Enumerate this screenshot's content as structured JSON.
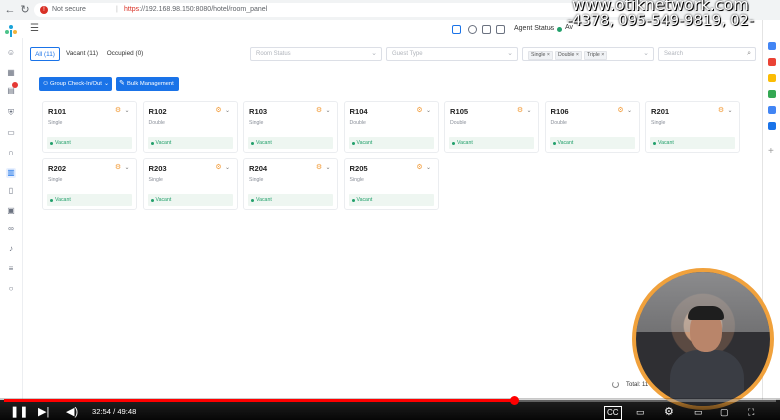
{
  "browser": {
    "security_label": "Not secure",
    "url_scheme": "https",
    "url_rest": "://192.168.98.150:8080/hotel/room_panel"
  },
  "header": {
    "agent_status_label": "Agent Status",
    "agent_status_value": "Av"
  },
  "filters": {
    "tabs": [
      {
        "label": "All (11)",
        "active": true
      },
      {
        "label": "Vacant (11)",
        "active": false
      },
      {
        "label": "Occupied (0)",
        "active": false
      }
    ],
    "room_status_placeholder": "Room Status",
    "guest_type_placeholder": "Guest Type",
    "room_type_tags": [
      "Single",
      "Double",
      "Triple"
    ],
    "search_placeholder": "Search"
  },
  "actions": {
    "group_check": "Group Check-In/Out",
    "batch": "Bulk Management"
  },
  "rooms": [
    {
      "number": "R101",
      "type": "Single",
      "status": "Vacant"
    },
    {
      "number": "R102",
      "type": "Double",
      "status": "Vacant"
    },
    {
      "number": "R103",
      "type": "Single",
      "status": "Vacant"
    },
    {
      "number": "R104",
      "type": "Double",
      "status": "Vacant"
    },
    {
      "number": "R105",
      "type": "Double",
      "status": "Vacant"
    },
    {
      "number": "R106",
      "type": "Double",
      "status": "Vacant"
    },
    {
      "number": "R201",
      "type": "Single",
      "status": "Vacant"
    },
    {
      "number": "R202",
      "type": "Single",
      "status": "Vacant"
    },
    {
      "number": "R203",
      "type": "Single",
      "status": "Vacant"
    },
    {
      "number": "R204",
      "type": "Single",
      "status": "Vacant"
    },
    {
      "number": "R205",
      "type": "Single",
      "status": "Vacant"
    }
  ],
  "footer": {
    "total": "Total: 11"
  },
  "overlay": {
    "watermark": "www.otiknetwork.com",
    "phone": "-4378, 095-549-9819, 02-"
  },
  "video": {
    "time": "32:54 / 49:48",
    "progress": 0.66
  },
  "colors": {
    "accent": "#1a73e8",
    "vacant": "#22a06b",
    "progress": "#ff0000",
    "face_ring": "#f0a13c"
  }
}
